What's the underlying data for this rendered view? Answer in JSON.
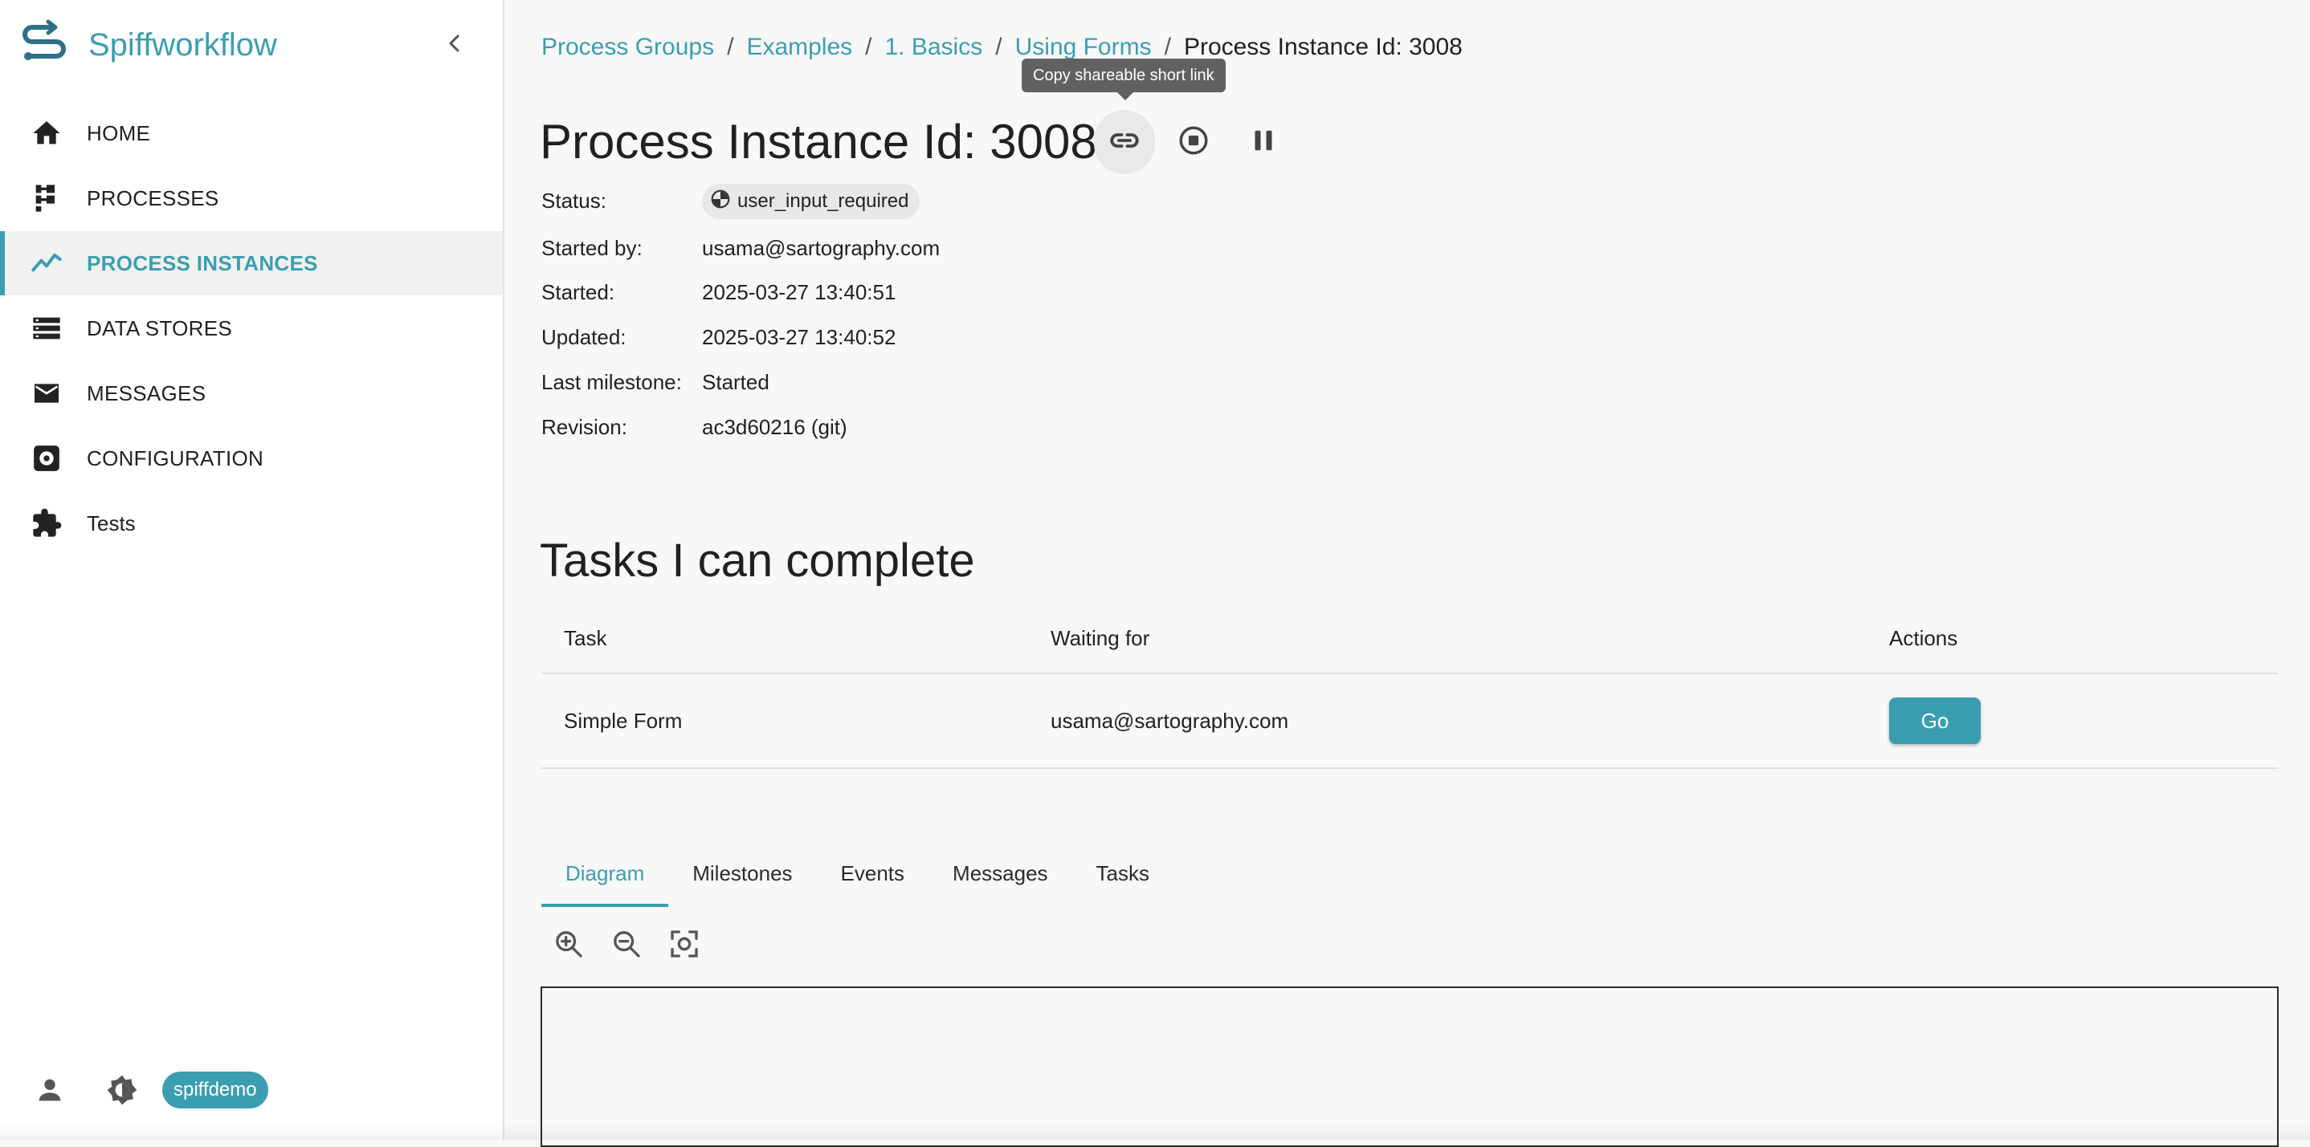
{
  "app": {
    "name": "Spiffworkflow",
    "accent_color": "#3b9eb0"
  },
  "sidebar": {
    "items": [
      {
        "label": "HOME",
        "icon": "home-icon",
        "active": false
      },
      {
        "label": "PROCESSES",
        "icon": "process-tree-icon",
        "active": false
      },
      {
        "label": "PROCESS INSTANCES",
        "icon": "trending-line-icon",
        "active": true
      },
      {
        "label": "DATA STORES",
        "icon": "storage-list-icon",
        "active": false
      },
      {
        "label": "MESSAGES",
        "icon": "envelope-icon",
        "active": false
      },
      {
        "label": "CONFIGURATION",
        "icon": "settings-box-icon",
        "active": false
      },
      {
        "label": "Tests",
        "icon": "puzzle-icon",
        "active": false
      }
    ],
    "footer": {
      "tenant": "spiffdemo"
    }
  },
  "breadcrumb": {
    "items": [
      "Process Groups",
      "Examples",
      "1. Basics",
      "Using Forms"
    ],
    "current": "Process Instance Id: 3008"
  },
  "tooltip": "Copy shareable short link",
  "instance": {
    "title": "Process Instance Id: 3008",
    "fields": {
      "status_label": "Status:",
      "status_value": "user_input_required",
      "started_by_label": "Started by:",
      "started_by_value": "usama@sartography.com",
      "started_label": "Started:",
      "started_value": "2025-03-27 13:40:51",
      "updated_label": "Updated:",
      "updated_value": "2025-03-27 13:40:52",
      "milestone_label": "Last milestone:",
      "milestone_value": "Started",
      "revision_label": "Revision:",
      "revision_value": "ac3d60216 (git)"
    }
  },
  "tasks": {
    "heading": "Tasks I can complete",
    "columns": [
      "Task",
      "Waiting for",
      "Actions"
    ],
    "rows": [
      {
        "task": "Simple Form",
        "waiting_for": "usama@sartography.com",
        "action": "Go"
      }
    ]
  },
  "tabs": [
    {
      "label": "Diagram",
      "active": true
    },
    {
      "label": "Milestones",
      "active": false
    },
    {
      "label": "Events",
      "active": false
    },
    {
      "label": "Messages",
      "active": false
    },
    {
      "label": "Tasks",
      "active": false
    }
  ],
  "zoom_tools": [
    "zoom-in-icon",
    "zoom-out-icon",
    "fit-to-screen-icon"
  ]
}
